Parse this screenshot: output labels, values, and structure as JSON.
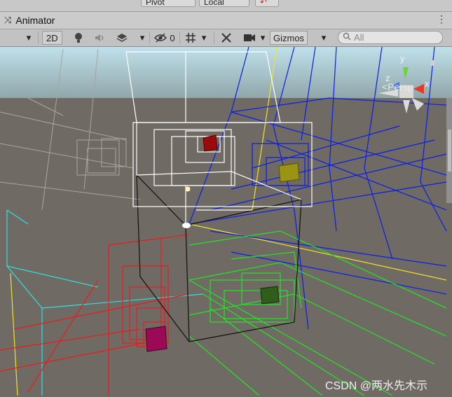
{
  "top_strip": {
    "pivot_label": "Pivot",
    "local_label": "Local"
  },
  "window": {
    "tab_title": "Animator",
    "tab_icon": "animator-icon"
  },
  "toolbar": {
    "mode_2d_label": "2D",
    "light_icon": "lightbulb-icon",
    "audio_icon": "speaker-icon",
    "effects_icon": "layers-icon",
    "hidden_icon": "eye-slash-icon",
    "hidden_count": "0",
    "grid_icon": "grid-icon",
    "tools_icon": "tools-icon",
    "camera_icon": "camera-icon",
    "gizmos_label": "Gizmos",
    "search_placeholder": "All"
  },
  "scene": {
    "projection_label": "Persp",
    "gizmo_axes": {
      "x": "x",
      "y": "y",
      "z": "z"
    },
    "colors": {
      "sky": "#aeccd6",
      "ground": "#6f6a64",
      "white": "#ffffff",
      "blue": "#0a1ee6",
      "red": "#ee1a1a",
      "green": "#22e622",
      "cyan": "#30e0e0",
      "yellow": "#f2e22a"
    }
  },
  "watermark": "CSDN @两水先木示"
}
